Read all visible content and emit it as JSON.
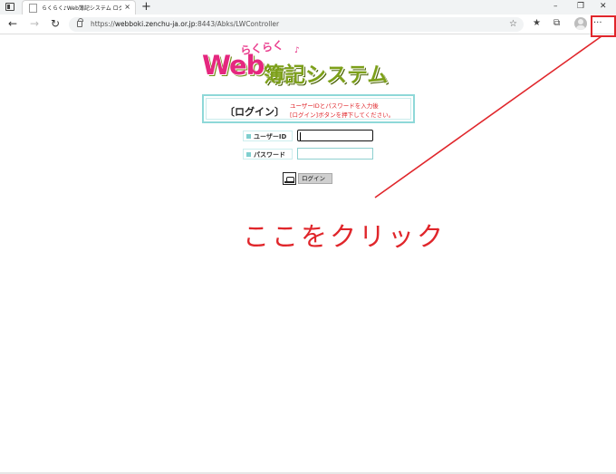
{
  "browser": {
    "tab_title": "らくらく♪Web簿記システム ログイン",
    "tab_close": "×",
    "new_tab": "+",
    "url_prefix": "https://",
    "url_host": "webboki.zenchu-ja.or.jp",
    "url_path": ":8443/Abks/LWController",
    "nav": {
      "back": "←",
      "forward": "→",
      "refresh": "↻"
    },
    "window": {
      "minimize": "–",
      "restore": "❐",
      "close": "✕"
    },
    "toolbar_icons": {
      "read_aloud": "A",
      "favorites_add": "☆",
      "favorites": "★",
      "collections": "⧉"
    },
    "more_menu": "···"
  },
  "page": {
    "logo": {
      "rakuraku": "らくらく",
      "note": "♪",
      "web": "Web",
      "rest": "簿記システム"
    },
    "login_title": "〔ログイン〕",
    "instructions": [
      "ユーザーIDとパスワードを入力後",
      "[ログイン]ボタンを押下してください。"
    ],
    "user_id_label": "ユーザーID",
    "password_label": "パスワード",
    "user_id_value": "",
    "password_value": "",
    "login_button": "ログイン"
  },
  "annotation": {
    "text": "ここをクリック",
    "color": "#e0262b"
  },
  "colors": {
    "brand_pink": "#e5277f",
    "brand_green": "#7da01a",
    "frame_teal": "#8ed8d8"
  }
}
